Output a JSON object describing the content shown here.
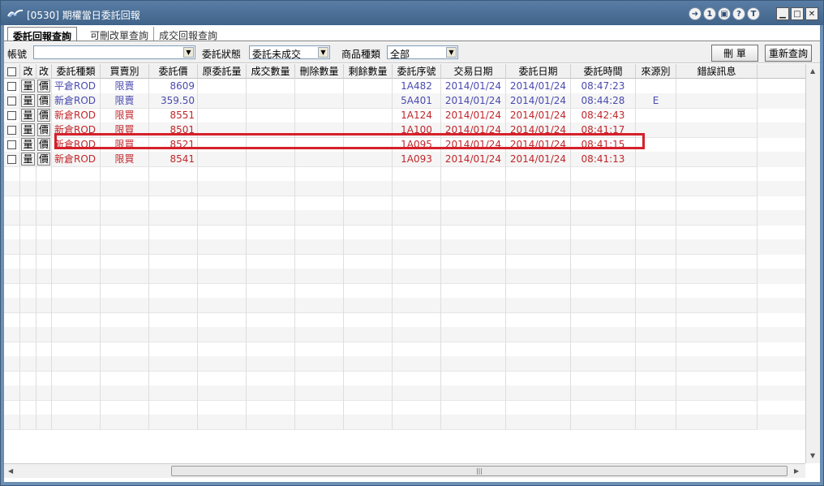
{
  "window": {
    "title": "[0530] 期權當日委託回報",
    "tb_icons": [
      "➜",
      "1",
      "▣",
      "?",
      "T"
    ],
    "win_controls": [
      "▁",
      "□",
      "✕"
    ]
  },
  "tabs": [
    {
      "label": "委託回報查詢",
      "active": true
    },
    {
      "label": "可刪改單查詢",
      "active": false
    },
    {
      "label": "成交回報查詢",
      "active": false
    }
  ],
  "filters": {
    "account_label": "帳號",
    "account_value": "",
    "status_label": "委託狀態",
    "status_value": "委託未成交",
    "product_label": "商品種類",
    "product_value": "全部",
    "delete_button": "刪 單",
    "requery_button": "重新查詢"
  },
  "table": {
    "headers": [
      "",
      "改",
      "改",
      "委託種類",
      "買賣別",
      "委託價",
      "原委託量",
      "成交數量",
      "刪除數量",
      "剩餘數量",
      "委託序號",
      "交易日期",
      "委託日期",
      "委託時間",
      "來源別",
      "錯誤訊息"
    ],
    "rows": [
      {
        "qty_btn": "量",
        "price_btn": "價",
        "type": "平倉ROD",
        "side": "限賣",
        "price": "8609",
        "orig_qty": "",
        "filled": "",
        "deleted": "",
        "remaining": "",
        "serial": "1A482",
        "trade_date": "2014/01/24",
        "order_date": "2014/01/24",
        "time": "08:47:23",
        "source": "",
        "error": "",
        "color": "sell"
      },
      {
        "qty_btn": "量",
        "price_btn": "價",
        "type": "新倉ROD",
        "side": "限賣",
        "price": "359.50",
        "orig_qty": "",
        "filled": "",
        "deleted": "",
        "remaining": "",
        "serial": "5A401",
        "trade_date": "2014/01/24",
        "order_date": "2014/01/24",
        "time": "08:44:28",
        "source": "E",
        "error": "",
        "color": "sell"
      },
      {
        "qty_btn": "量",
        "price_btn": "價",
        "type": "新倉ROD",
        "side": "限買",
        "price": "8551",
        "orig_qty": "",
        "filled": "",
        "deleted": "",
        "remaining": "",
        "serial": "1A124",
        "trade_date": "2014/01/24",
        "order_date": "2014/01/24",
        "time": "08:42:43",
        "source": "",
        "error": "",
        "color": "buy"
      },
      {
        "qty_btn": "量",
        "price_btn": "價",
        "type": "新倉ROD",
        "side": "限買",
        "price": "8501",
        "orig_qty": "",
        "filled": "",
        "deleted": "",
        "remaining": "",
        "serial": "1A100",
        "trade_date": "2014/01/24",
        "order_date": "2014/01/24",
        "time": "08:41:17",
        "source": "",
        "error": "",
        "color": "buy"
      },
      {
        "qty_btn": "量",
        "price_btn": "價",
        "type": "新倉ROD",
        "side": "限買",
        "price": "8521",
        "orig_qty": "",
        "filled": "",
        "deleted": "",
        "remaining": "",
        "serial": "1A095",
        "trade_date": "2014/01/24",
        "order_date": "2014/01/24",
        "time": "08:41:15",
        "source": "",
        "error": "",
        "color": "buy"
      },
      {
        "qty_btn": "量",
        "price_btn": "價",
        "type": "新倉ROD",
        "side": "限買",
        "price": "8541",
        "orig_qty": "",
        "filled": "",
        "deleted": "",
        "remaining": "",
        "serial": "1A093",
        "trade_date": "2014/01/24",
        "order_date": "2014/01/24",
        "time": "08:41:13",
        "source": "",
        "error": "",
        "color": "buy"
      }
    ],
    "empty_rows": 18
  },
  "colors": {
    "sell": "#4a4ab0",
    "buy": "#c0262b",
    "highlight": "#d5202a"
  }
}
